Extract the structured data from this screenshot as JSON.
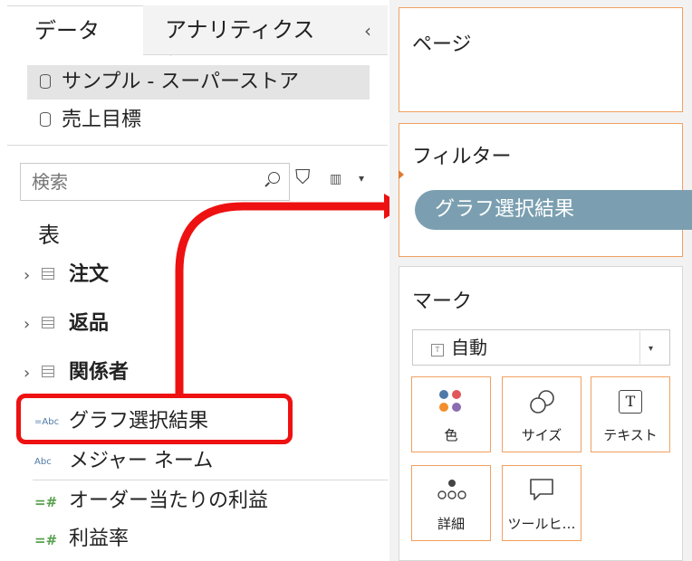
{
  "tabs": {
    "data": "データ",
    "analytics": "アナリティクス"
  },
  "collapse_icon": "‹",
  "datasources": [
    {
      "label": "サンプル - スーパーストア"
    },
    {
      "label": "売上目標"
    }
  ],
  "search": {
    "placeholder": "検索"
  },
  "section_label": "表",
  "tables": [
    {
      "label": "注文"
    },
    {
      "label": "返品"
    },
    {
      "label": "関係者"
    }
  ],
  "fields": [
    {
      "type_badge": "=Abc",
      "label": "グラフ選択結果"
    },
    {
      "type_badge": "Abc",
      "label": "メジャー ネーム"
    },
    {
      "type_badge": "=#",
      "label": "オーダー当たりの利益"
    },
    {
      "type_badge": "=#",
      "label": "利益率"
    }
  ],
  "shelves": {
    "pages": {
      "title": "ページ"
    },
    "filters": {
      "title": "フィルター",
      "pill": "グラフ選択結果"
    },
    "marks": {
      "title": "マーク",
      "mark_type": "自動",
      "buttons": [
        {
          "label": "色",
          "icon": "color-icon"
        },
        {
          "label": "サイズ",
          "icon": "size-icon"
        },
        {
          "label": "テキスト",
          "icon": "text-icon"
        },
        {
          "label": "詳細",
          "icon": "detail-icon"
        },
        {
          "label": "ツールヒ…",
          "icon": "tooltip-icon"
        }
      ]
    }
  },
  "colors": {
    "highlight": "#ee1111",
    "pill": "#7b9fb0",
    "card_border": "#f0a060"
  }
}
